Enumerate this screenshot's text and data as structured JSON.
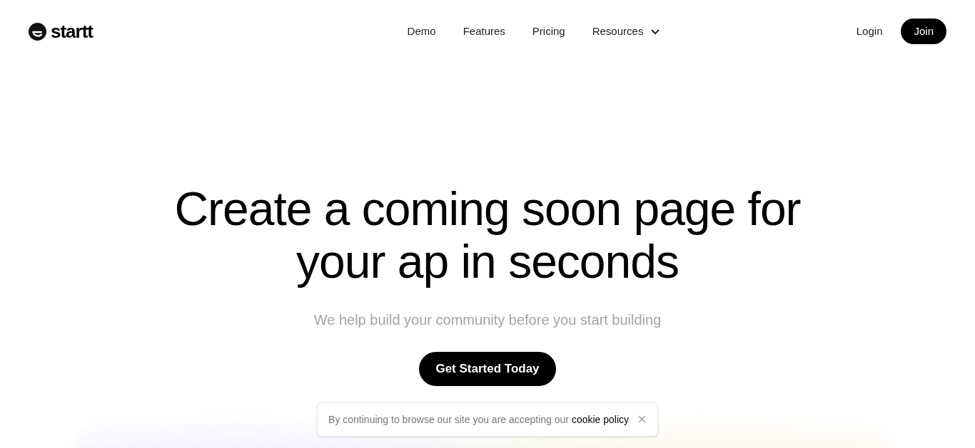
{
  "brand": {
    "name": "startt"
  },
  "nav": [
    {
      "label": "Demo",
      "has_menu": false
    },
    {
      "label": "Features",
      "has_menu": false
    },
    {
      "label": "Pricing",
      "has_menu": false
    },
    {
      "label": "Resources",
      "has_menu": true
    }
  ],
  "actions": {
    "login": "Login",
    "join": "Join"
  },
  "hero": {
    "title": "Create a coming soon page for your ap in seconds",
    "subtitle": "We help build your community before you start building",
    "cta": "Get Started Today"
  },
  "cookie_banner": {
    "text": "By continuing to browse our site you are accepting our",
    "link": "cookie policy",
    "close": "×"
  }
}
